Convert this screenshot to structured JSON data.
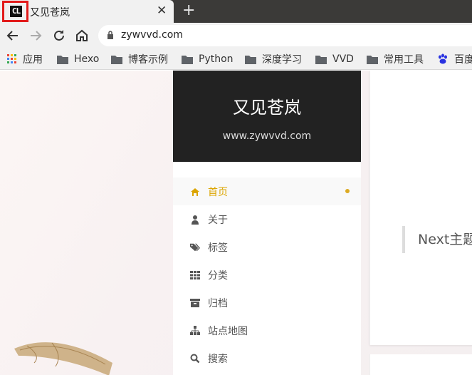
{
  "browser": {
    "tab": {
      "favicon_text": "CL",
      "title": "又见苍岚"
    },
    "address_bar": {
      "url": "zywvvd.com"
    },
    "bookmarks": [
      "应用",
      "Hexo",
      "博客示例",
      "Python",
      "深度学习",
      "VVD",
      "常用工具",
      "百度"
    ]
  },
  "site": {
    "title": "又见苍岚",
    "subtitle": "www.zywvvd.com",
    "menu": [
      {
        "label": "首页",
        "icon": "home-icon",
        "active": true
      },
      {
        "label": "关于",
        "icon": "user-icon"
      },
      {
        "label": "标签",
        "icon": "tags-icon"
      },
      {
        "label": "分类",
        "icon": "grid-icon"
      },
      {
        "label": "归档",
        "icon": "archive-icon"
      },
      {
        "label": "站点地图",
        "icon": "sitemap-icon"
      },
      {
        "label": "搜索",
        "icon": "search-icon"
      }
    ]
  },
  "content": {
    "quote_text": "Next主题"
  },
  "colors": {
    "accent": "#dca500",
    "brand_bg": "#222222",
    "favicon_highlight": "#e21b1b"
  }
}
